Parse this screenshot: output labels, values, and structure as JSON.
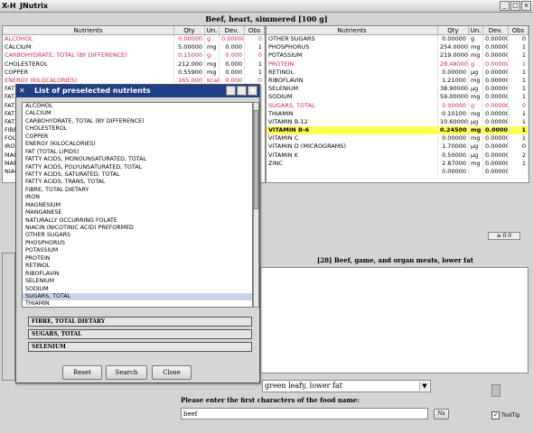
{
  "window": {
    "title": "JNutrix",
    "icon": "X-H",
    "btn_min": "_",
    "btn_max": "□",
    "btn_close": "×"
  },
  "food_title": "Beef, heart, simmered [100 g]",
  "table_headers": {
    "nutrients": "Nutrients",
    "qty": "Qty",
    "un": "Un.",
    "dev": "Dev.",
    "obs": "Obs"
  },
  "left_rows": [
    {
      "n": "ALCOHOL",
      "q": "0.00000",
      "u": "g",
      "d": "0.00000",
      "o": "0",
      "red": true
    },
    {
      "n": "CALCIUM",
      "q": "5.00000",
      "u": "mg",
      "d": "0.000",
      "o": "1",
      "red": false
    },
    {
      "n": "CARBOHYDRATE, TOTAL (BY DIFFERENCE)",
      "q": "0.15000",
      "u": "g",
      "d": "0.000",
      "o": "0",
      "red": true
    },
    {
      "n": "CHOLESTEROL",
      "q": "212.000",
      "u": "mg",
      "d": "0.000",
      "o": "1",
      "red": false
    },
    {
      "n": "COPPER",
      "q": "0.55900",
      "u": "mg",
      "d": "0.000",
      "o": "1",
      "red": false
    },
    {
      "n": "ENERGY (KILOCALORIES)",
      "q": "165.000",
      "u": "kcal",
      "d": "0.000",
      "o": "0",
      "red": true
    }
  ],
  "left_partial": [
    "FAT",
    "FAT",
    "FAT",
    "FAT",
    "FAT",
    "FIBR",
    "FOLA",
    "IRON",
    "MAG",
    "MAN",
    "NIAC"
  ],
  "right_rows": [
    {
      "n": "OTHER SUGARS",
      "q": "0.00000",
      "u": "g",
      "d": "0.00000",
      "o": "0",
      "red": false
    },
    {
      "n": "PHOSPHORUS",
      "q": "254.00000",
      "u": "mg",
      "d": "0.00000",
      "o": "1",
      "red": false
    },
    {
      "n": "POTASSIUM",
      "q": "219.00000",
      "u": "mg",
      "d": "0.00000",
      "o": "1",
      "red": false
    },
    {
      "n": "PROTEIN",
      "q": "28.48000",
      "u": "g",
      "d": "0.00000",
      "o": "1",
      "red": true
    },
    {
      "n": "RETINOL",
      "q": "0.00000",
      "u": "µg",
      "d": "0.00000",
      "o": "1",
      "red": false
    },
    {
      "n": "RIBOFLAVIN",
      "q": "1.21000",
      "u": "mg",
      "d": "0.00000",
      "o": "1",
      "red": false
    },
    {
      "n": "SELENIUM",
      "q": "38.90000",
      "u": "µg",
      "d": "0.00000",
      "o": "1",
      "red": false
    },
    {
      "n": "SODIUM",
      "q": "59.00000",
      "u": "mg",
      "d": "0.00000",
      "o": "1",
      "red": false
    },
    {
      "n": "SUGARS, TOTAL",
      "q": "0.00000",
      "u": "g",
      "d": "0.00000",
      "o": "0",
      "red": true
    },
    {
      "n": "THIAMIN",
      "q": "0.10100",
      "u": "mg",
      "d": "0.00000",
      "o": "1",
      "red": false
    },
    {
      "n": "VITAMIN B-12",
      "q": "10.60000",
      "u": "µg",
      "d": "0.00000",
      "o": "1",
      "red": false
    },
    {
      "n": "VITAMIN B-6",
      "q": "0.24500",
      "u": "mg",
      "d": "0.00000",
      "o": "1",
      "red": false,
      "hl": true
    },
    {
      "n": "VITAMIN C",
      "q": "0.00000",
      "u": "mg",
      "d": "0.00000",
      "o": "1",
      "red": false
    },
    {
      "n": "VITAMIN D (MICROGRAMS)",
      "q": "1.70000",
      "u": "µg",
      "d": "0.00000",
      "o": "0",
      "red": false
    },
    {
      "n": "VITAMIN K",
      "q": "0.50000",
      "u": "µg",
      "d": "0.00000",
      "o": "2",
      "red": false
    },
    {
      "n": "ZINC",
      "q": "2.87000",
      "u": "mg",
      "d": "0.00000",
      "o": "1",
      "red": false
    },
    {
      "n": "",
      "q": "0.00000",
      "u": "",
      "d": "0.00000",
      "o": "",
      "red": false
    }
  ],
  "scale_label": "≥ 0.0",
  "food_group_title": "[28] Beef, game, and organ meats, lower fat",
  "food_group_combo": "green leafy, lower fat",
  "search_prompt": "Please enter the first characters of the food name:",
  "search_value": "beef",
  "search_btn": "Nx",
  "tooltip_label": "ToolTip",
  "dialog": {
    "title": "List of preselected nutrients",
    "items": [
      "ALCOHOL",
      "CALCIUM",
      "CARBOHYDRATE, TOTAL (BY DIFFERENCE)",
      "CHOLESTEROL",
      "COPPER",
      "ENERGY (KILOCALORIES)",
      "FAT (TOTAL LIPIDS)",
      "FATTY ACIDS, MONOUNSATURATED, TOTAL",
      "FATTY ACIDS, POLYUNSATURATED, TOTAL",
      "FATTY ACIDS, SATURATED, TOTAL",
      "FATTY ACIDS, TRANS, TOTAL",
      "FIBRE, TOTAL DIETARY",
      "IRON",
      "MAGNESIUM",
      "MANGANESE",
      "NATURALLY OCCURRING FOLATE",
      "NIACIN (NICOTINIC ACID) PREFORMED",
      "OTHER SUGARS",
      "PHOSPHORUS",
      "POTASSIUM",
      "PROTEIN",
      "RETINOL",
      "RIBOFLAVIN",
      "SELENIUM",
      "SODIUM",
      "SUGARS, TOTAL",
      "THIAMIN"
    ],
    "selected_index": 25,
    "chips": [
      "FIBRE, TOTAL DIETARY",
      "SUGARS, TOTAL",
      "SELENIUM"
    ],
    "reset": "Reset",
    "search": "Search",
    "close": "Close"
  }
}
